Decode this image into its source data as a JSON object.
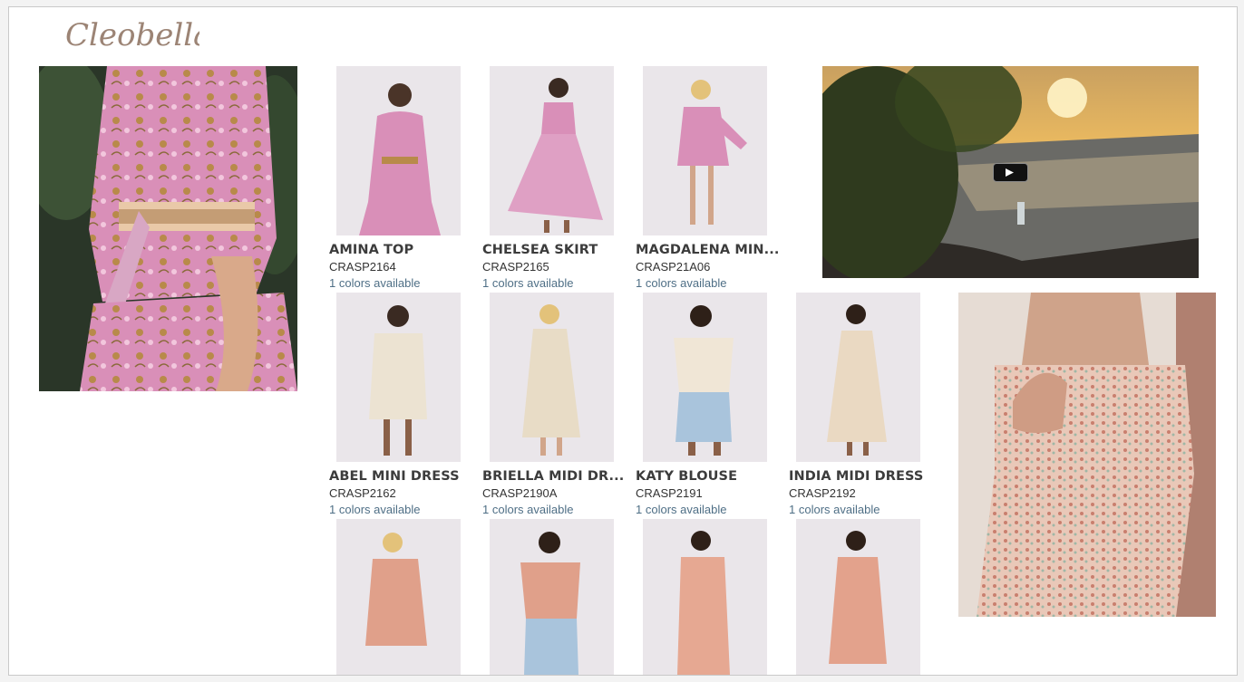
{
  "brand": {
    "name": "Cleobella"
  },
  "lookbook": {
    "video": {
      "play_icon": "play-icon"
    },
    "products": [
      {
        "name": "AMINA TOP",
        "sku": "CRASP2164",
        "colors": "1 colors available"
      },
      {
        "name": "CHELSEA SKIRT",
        "sku": "CRASP2165",
        "colors": "1 colors available"
      },
      {
        "name": "MAGDALENA MIN...",
        "sku": "CRASP21A06",
        "colors": "1 colors available"
      },
      {
        "name": "ABEL MINI DRESS",
        "sku": "CRASP2162",
        "colors": "1 colors available"
      },
      {
        "name": "BRIELLA MIDI DR...",
        "sku": "CRASP2190A",
        "colors": "1 colors available"
      },
      {
        "name": "KATY BLOUSE",
        "sku": "CRASP2191",
        "colors": "1 colors available"
      },
      {
        "name": "INDIA MIDI DRESS",
        "sku": "CRASP2192",
        "colors": "1 colors available"
      }
    ]
  },
  "colors": {
    "product_name": "#3c3c3c",
    "colors_link": "#4f6f86",
    "pink_print": "#d98fb8",
    "cream_print": "#ece3d2",
    "coral_print": "#e0a08a"
  }
}
